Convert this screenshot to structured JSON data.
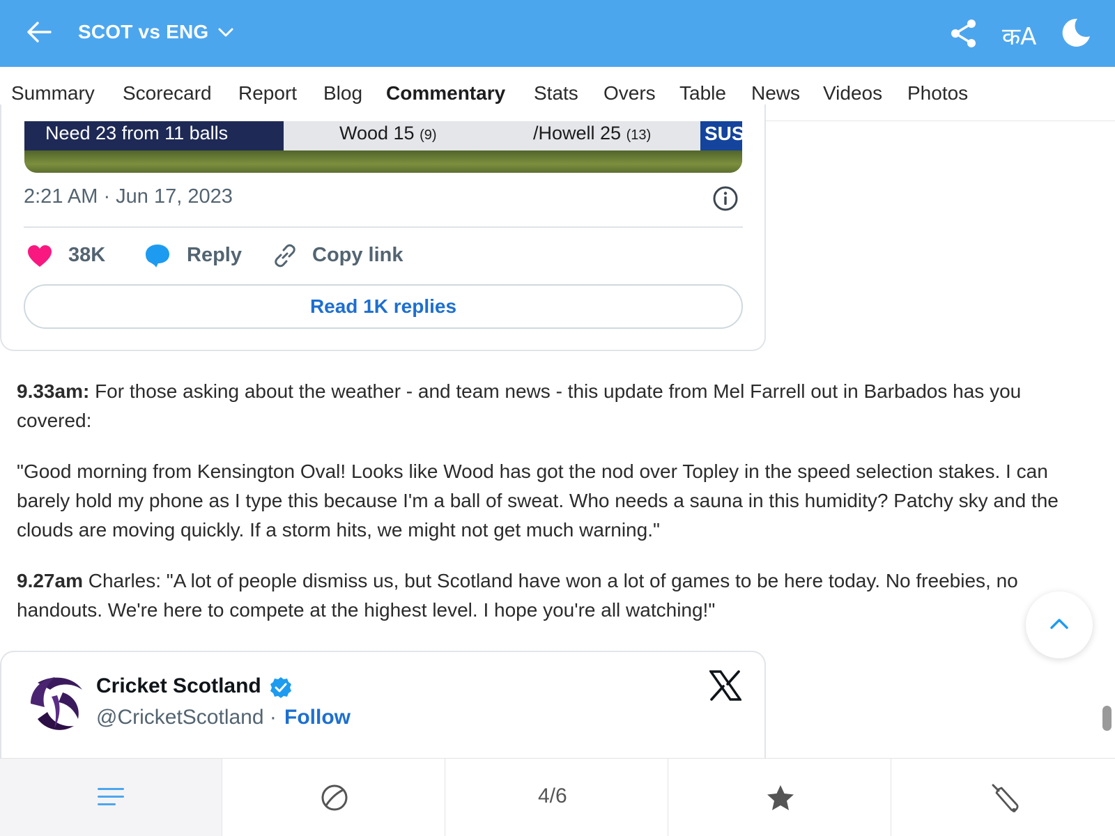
{
  "header": {
    "title": "SCOT vs ENG",
    "lang_toggle": "कA",
    "background_color": "#4ca6ee"
  },
  "tabs": [
    {
      "label": "Summary",
      "active": false
    },
    {
      "label": "Scorecard",
      "active": false
    },
    {
      "label": "Report",
      "active": false
    },
    {
      "label": "Blog",
      "active": false
    },
    {
      "label": "Commentary",
      "active": true
    },
    {
      "label": "Stats",
      "active": false
    },
    {
      "label": "Overs",
      "active": false
    },
    {
      "label": "Table",
      "active": false
    },
    {
      "label": "News",
      "active": false
    },
    {
      "label": "Videos",
      "active": false
    },
    {
      "label": "Photos",
      "active": false
    }
  ],
  "embedded_tweet_1": {
    "media_scorebar": {
      "need": "Need 23 from 11 balls",
      "batter1_name": "Wood 15",
      "batter1_balls": "(9)",
      "batter2_name": "Howell 25",
      "batter2_balls": "(13)",
      "team_badge": "SUS"
    },
    "timestamp": "2:21 AM · Jun 17, 2023",
    "likes": "38K",
    "reply_label": "Reply",
    "copy_link_label": "Copy link",
    "read_replies_label": "Read 1K replies"
  },
  "commentary": [
    {
      "time": "9.33am:",
      "text": " For those asking about the weather - and team news - this update from Mel Farrell out in Barbados has you covered:"
    },
    {
      "time": "",
      "text": "\"Good morning from Kensington Oval! Looks like Wood has got the nod over Topley in the speed selection stakes. I can barely hold my phone as I type this because I'm a ball of sweat. Who needs a sauna in this humidity? Patchy sky and the clouds are moving quickly. If a storm hits, we might not get much warning.\""
    },
    {
      "time": "9.27am",
      "text": " Charles: \"A lot of people dismiss us, but Scotland have won a lot of games to be here today. No freebies, no handouts. We're here to compete at the highest level. I hope you're all watching!\""
    }
  ],
  "embedded_tweet_2": {
    "account_name": "Cricket Scotland",
    "handle": "@CricketScotland",
    "separator": " · ",
    "follow_label": "Follow",
    "verified": true
  },
  "bottom_nav": {
    "items": [
      "menu-icon",
      "ball-icon",
      "page-indicator",
      "star-icon",
      "bat-icon"
    ],
    "page_indicator": "4/6"
  },
  "colors": {
    "accent": "#4ca6ee",
    "link": "#1d6fd0",
    "heart": "#f91880",
    "reply_bubble": "#1d9bf0"
  }
}
